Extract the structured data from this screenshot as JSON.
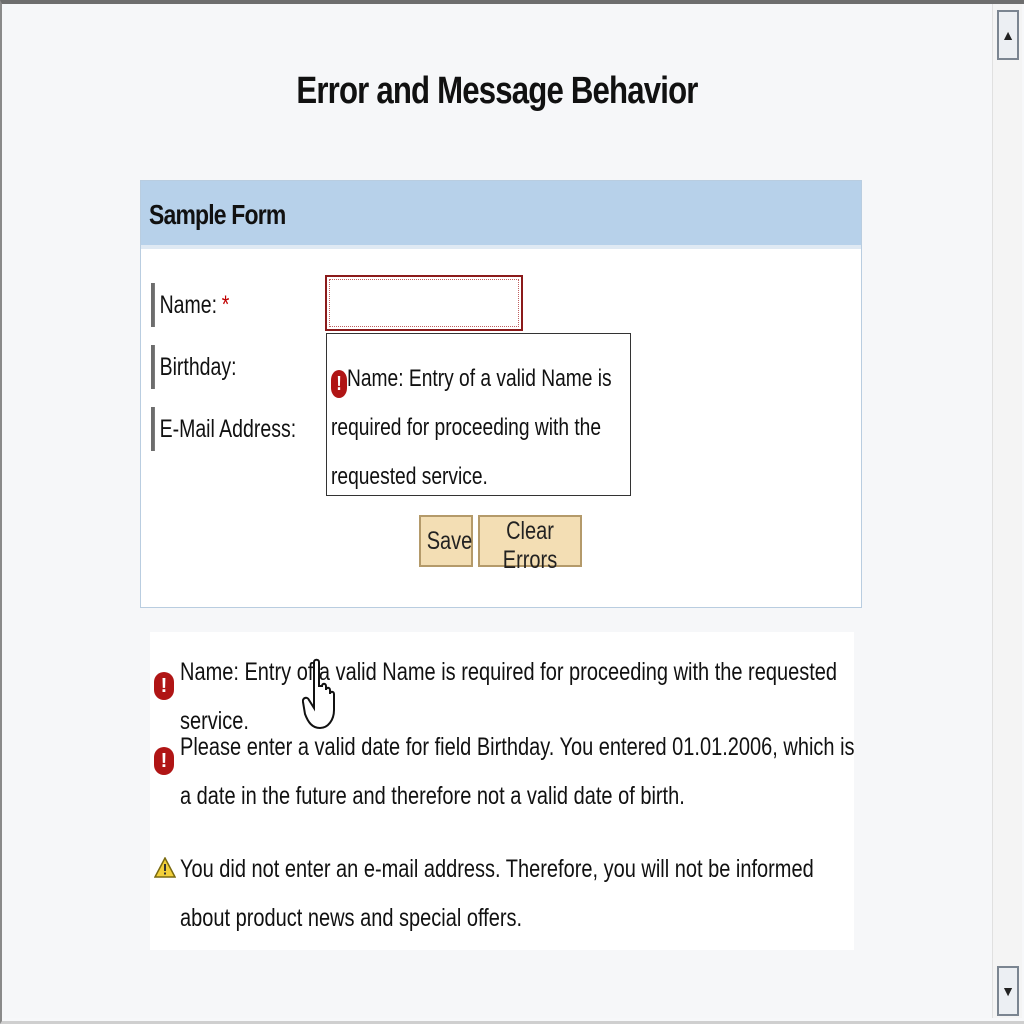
{
  "page": {
    "title": "Error and Message Behavior"
  },
  "form": {
    "title": "Sample Form",
    "fields": [
      {
        "label": "Name:",
        "required_marker": "*",
        "value": ""
      },
      {
        "label": "Birthday:"
      },
      {
        "label": "E-Mail Address:"
      }
    ],
    "tooltip": "Name: Entry of a valid Name is required for proceeding with the requested service.",
    "buttons": {
      "save": "Save",
      "clear": "Clear Errors"
    }
  },
  "messages": [
    {
      "type": "error",
      "icon": "error-icon",
      "text": "Name: Entry of a valid Name is required for proceeding with the requested service."
    },
    {
      "type": "error",
      "icon": "error-icon",
      "text": "Please enter a valid date for field Birthday. You entered 01.01.2006, which is a date in the future  and therefore not a valid date of birth."
    },
    {
      "type": "warning",
      "icon": "warning-icon",
      "text": "You did not enter an e-mail address. Therefore, you will not be informed about product news and special offers."
    }
  ],
  "scrollbar": {
    "up_icon": "scroll-up-arrow-icon",
    "down_icon": "scroll-down-arrow-icon"
  },
  "colors": {
    "header_blue": "#b7d1ea",
    "button_bg": "#f3deb4",
    "error_red": "#b01515",
    "warning_yellow": "#f2d03b"
  }
}
